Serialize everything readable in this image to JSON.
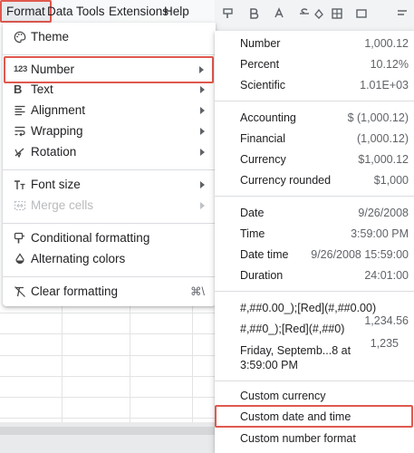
{
  "menubar": {
    "items": [
      "Format",
      "Data",
      "Tools",
      "Extensions",
      "Help"
    ]
  },
  "format_menu": {
    "theme": "Theme",
    "number": "Number",
    "text": "Text",
    "alignment": "Alignment",
    "wrapping": "Wrapping",
    "rotation": "Rotation",
    "font_size": "Font size",
    "merge_cells": "Merge cells",
    "conditional_formatting": "Conditional formatting",
    "alternating_colors": "Alternating colors",
    "clear_formatting": "Clear formatting",
    "clear_formatting_shortcut": "⌘\\",
    "number_icon_text": "123",
    "text_icon_text": "B"
  },
  "number_menu": {
    "rows": [
      {
        "label": "Number",
        "value": "1,000.12"
      },
      {
        "label": "Percent",
        "value": "10.12%"
      },
      {
        "label": "Scientific",
        "value": "1.01E+03"
      },
      {
        "label": "Accounting",
        "value": "$ (1,000.12)"
      },
      {
        "label": "Financial",
        "value": "(1,000.12)"
      },
      {
        "label": "Currency",
        "value": "$1,000.12"
      },
      {
        "label": "Currency rounded",
        "value": "$1,000"
      },
      {
        "label": "Date",
        "value": "9/26/2008"
      },
      {
        "label": "Time",
        "value": "3:59:00 PM"
      },
      {
        "label": "Date time",
        "value": "9/26/2008 15:59:00"
      },
      {
        "label": "Duration",
        "value": "24:01:00"
      }
    ],
    "custom_formats": [
      {
        "label": "#,##0.00_);[Red](#,##0.00)",
        "value": "1,234.56"
      },
      {
        "label": "#,##0_);[Red](#,##0)",
        "value": "1,235"
      },
      {
        "label": "Friday, Septemb...8 at",
        "label2": "3:59:00 PM"
      }
    ],
    "custom_currency": "Custom currency",
    "custom_date_time": "Custom date and time",
    "custom_number_format": "Custom number format"
  },
  "colors": {
    "highlight_border": "#e0584e",
    "menubar_bg": "#f8f9fa",
    "separator": "#dadce0"
  }
}
